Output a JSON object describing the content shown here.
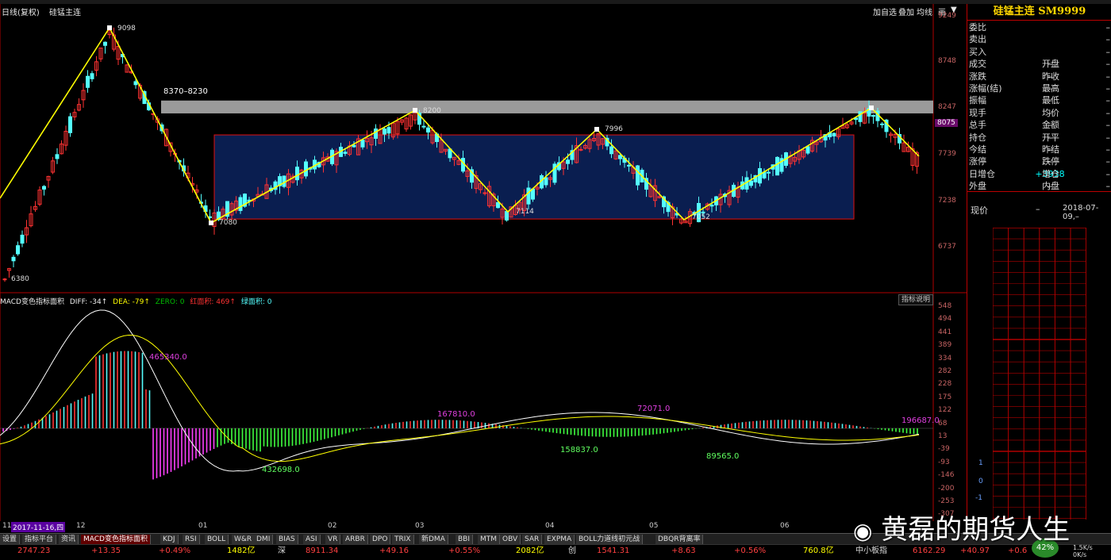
{
  "window": {
    "mode_label": "日线(复权)",
    "instrument_label": "硅锰主连"
  },
  "toolbar_right": {
    "add_self": "加自选",
    "overlay": "叠加",
    "period": "均线",
    "icon_a": "画",
    "icon_b": "▼"
  },
  "panel": {
    "title": "硅锰主连  SM9999",
    "quote_rows": [
      {
        "left": "委比",
        "right_value": "–"
      },
      {
        "left": "卖出",
        "right_value": "–"
      },
      {
        "left": "买入",
        "right_value": "–"
      },
      {
        "left": "成交",
        "mid": "–",
        "right": "开盘",
        "right_value": "–"
      },
      {
        "left": "涨跌",
        "mid": "–",
        "right": "昨收",
        "right_value": "–"
      },
      {
        "left": "涨幅(结)",
        "mid": "–",
        "right": "最高",
        "right_value": "–"
      },
      {
        "left": "振幅",
        "mid": "–",
        "right": "最低",
        "right_value": "–"
      },
      {
        "left": "现手",
        "mid": "–",
        "right": "均价",
        "right_value": "–"
      },
      {
        "left": "总手",
        "mid": "–",
        "right": "金额",
        "right_value": "–"
      },
      {
        "left": "持仓",
        "mid": "–",
        "right": "开平",
        "right_value": "–"
      },
      {
        "left": "今结",
        "mid": "–",
        "right": "昨结",
        "right_value": "–"
      },
      {
        "left": "涨停",
        "mid": "–",
        "right": "跌停",
        "right_value": "–"
      },
      {
        "left": "日增仓",
        "mid": "+3938",
        "right": "增仓",
        "right_value": "–"
      },
      {
        "left": "外盘",
        "mid": "–",
        "right": "内盘",
        "right_value": "–"
      }
    ],
    "now_price_label": "现价",
    "now_price_value": "–",
    "date_value": "2018-07-09,–",
    "grid_labels": [
      "1",
      "0",
      "-1"
    ]
  },
  "price_axis": [
    "9249",
    "8748",
    "8247",
    "8075",
    "7739",
    "7238",
    "6737"
  ],
  "price_axis_current": "8075",
  "annotations": {
    "high": "9098",
    "low_start": "6380",
    "resistance": "8370–8230",
    "p7080": "7080",
    "p8200": "8200",
    "p7114": "7114",
    "p7996": "7996",
    "p7052": "7052"
  },
  "indicator": {
    "title": "MACD变色指标面积",
    "diff_label": "DIFF:",
    "diff_value": "-34↑",
    "dea_label": "DEA:",
    "dea_value": "-79↑",
    "zero_label": "ZERO: 0",
    "red_label": "红面积: 469↑",
    "green_label": "绿面积: 0",
    "help_button": "指标说明",
    "axis": [
      "548",
      "494",
      "441",
      "389",
      "334",
      "282",
      "228",
      "175",
      "122",
      "68",
      "13",
      "-39",
      "-93",
      "-146",
      "-200",
      "-253",
      "-307",
      "-360"
    ],
    "area_labels": [
      "465340.0",
      "432698.0",
      "167810.0",
      "158837.0",
      "72071.0",
      "89565.0",
      "196687.0"
    ]
  },
  "time_axis": {
    "first_label": "11",
    "highlight": "2017-11-16,四",
    "months": [
      "12",
      "01",
      "02",
      "03",
      "04",
      "05",
      "06"
    ]
  },
  "tabs": [
    "设置",
    "指标平台",
    "资讯",
    "MACD变色指标面积",
    "KDJ",
    "RSI",
    "BOLL",
    "W&R",
    "DMI",
    "BIAS",
    "ASI",
    "VR",
    "ARBR",
    "DPO",
    "TRIX",
    "新DMA",
    "BBI",
    "MTM",
    "OBV",
    "SAR",
    "EXPMA",
    "BOLL力道线初元战",
    "DBQR背离率"
  ],
  "status": {
    "sh_value": "2747.23",
    "sh_change": "+13.35",
    "sh_pct": "+0.49%",
    "sh_amount": "1482亿",
    "sz_label": "深",
    "sz_value": "8911.34",
    "sz_change": "+49.16",
    "sz_pct": "+0.55%",
    "sz_amount": "2082亿",
    "cy_label": "创",
    "cy_value": "1541.31",
    "cy_change": "+8.63",
    "cy_pct": "+0.56%",
    "cy_amount": "760.8亿",
    "zx_label": "中小板指",
    "zx_value": "6162.29",
    "zx_change": "+40.97",
    "zx_pct": "+0.6",
    "net_pct": "42%",
    "net_up": "1.5K/s",
    "net_down": "0K/s"
  },
  "watermark": "黄磊的期货人生",
  "colors": {
    "up": "#ff3232",
    "down": "#54ffff",
    "zigzag": "#ffff00",
    "resist_band": "#9a9a9a",
    "box_fill": "#0a1e50",
    "box_border": "#e01010",
    "grid": "#b00000"
  }
}
